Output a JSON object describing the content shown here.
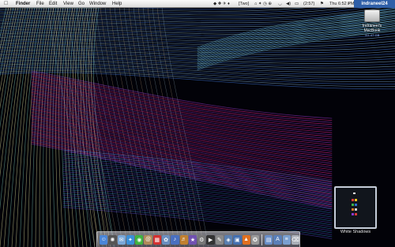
{
  "menubar": {
    "apple": "",
    "app": "Finder",
    "menus": [
      "File",
      "Edit",
      "View",
      "Go",
      "Window",
      "Help"
    ],
    "tray_music": "[Two]",
    "tray_battery": "(2:57)",
    "clock": "Thu 6:52 PM",
    "user": "indraneel24"
  },
  "drive": {
    "name": "Indraneel's MacBook",
    "size": "111.47 GB"
  },
  "album": {
    "title": "White Shadows"
  },
  "dock": {
    "items": [
      {
        "name": "finder-icon",
        "color": "#4a86d8",
        "glyph": "☺"
      },
      {
        "name": "widget-icon",
        "color": "#555",
        "glyph": "✺"
      },
      {
        "name": "mail-icon",
        "color": "#7aa7d8",
        "glyph": "✉"
      },
      {
        "name": "safari-icon",
        "color": "#3b8fd8",
        "glyph": "✦"
      },
      {
        "name": "chat-icon",
        "color": "#3fb43f",
        "glyph": "◉"
      },
      {
        "name": "addressbook-icon",
        "color": "#b08a5a",
        "glyph": "@"
      },
      {
        "name": "calendar-icon",
        "color": "#d43030",
        "glyph": "▦"
      },
      {
        "name": "iphoto-icon",
        "color": "#6b8fbf",
        "glyph": "✿"
      },
      {
        "name": "itunes-icon",
        "color": "#4a70c0",
        "glyph": "♪"
      },
      {
        "name": "garageband-icon",
        "color": "#c08030",
        "glyph": "♬"
      },
      {
        "name": "imovie-icon",
        "color": "#7050b0",
        "glyph": "★"
      },
      {
        "name": "sysprefs-icon",
        "color": "#777",
        "glyph": "⚙"
      },
      {
        "name": "terminal-icon",
        "color": "#333",
        "glyph": "▶"
      },
      {
        "name": "textedit-icon",
        "color": "#888",
        "glyph": "✎"
      },
      {
        "name": "preview-icon",
        "color": "#5a7fb0",
        "glyph": "◈"
      },
      {
        "name": "monitor-icon",
        "color": "#4470b0",
        "glyph": "▣"
      },
      {
        "name": "vlc-icon",
        "color": "#e07020",
        "glyph": "▲"
      },
      {
        "name": "gear-icon",
        "color": "#999",
        "glyph": "✪"
      }
    ],
    "right_items": [
      {
        "name": "folder-icon",
        "color": "#6a8fc8",
        "glyph": "▤"
      },
      {
        "name": "applications-icon",
        "color": "#5a7fb8",
        "glyph": "A"
      },
      {
        "name": "documents-icon",
        "color": "#7a9fd0",
        "glyph": "≡"
      },
      {
        "name": "trash-icon",
        "color": "#aab0b8",
        "glyph": "⌫"
      }
    ]
  }
}
